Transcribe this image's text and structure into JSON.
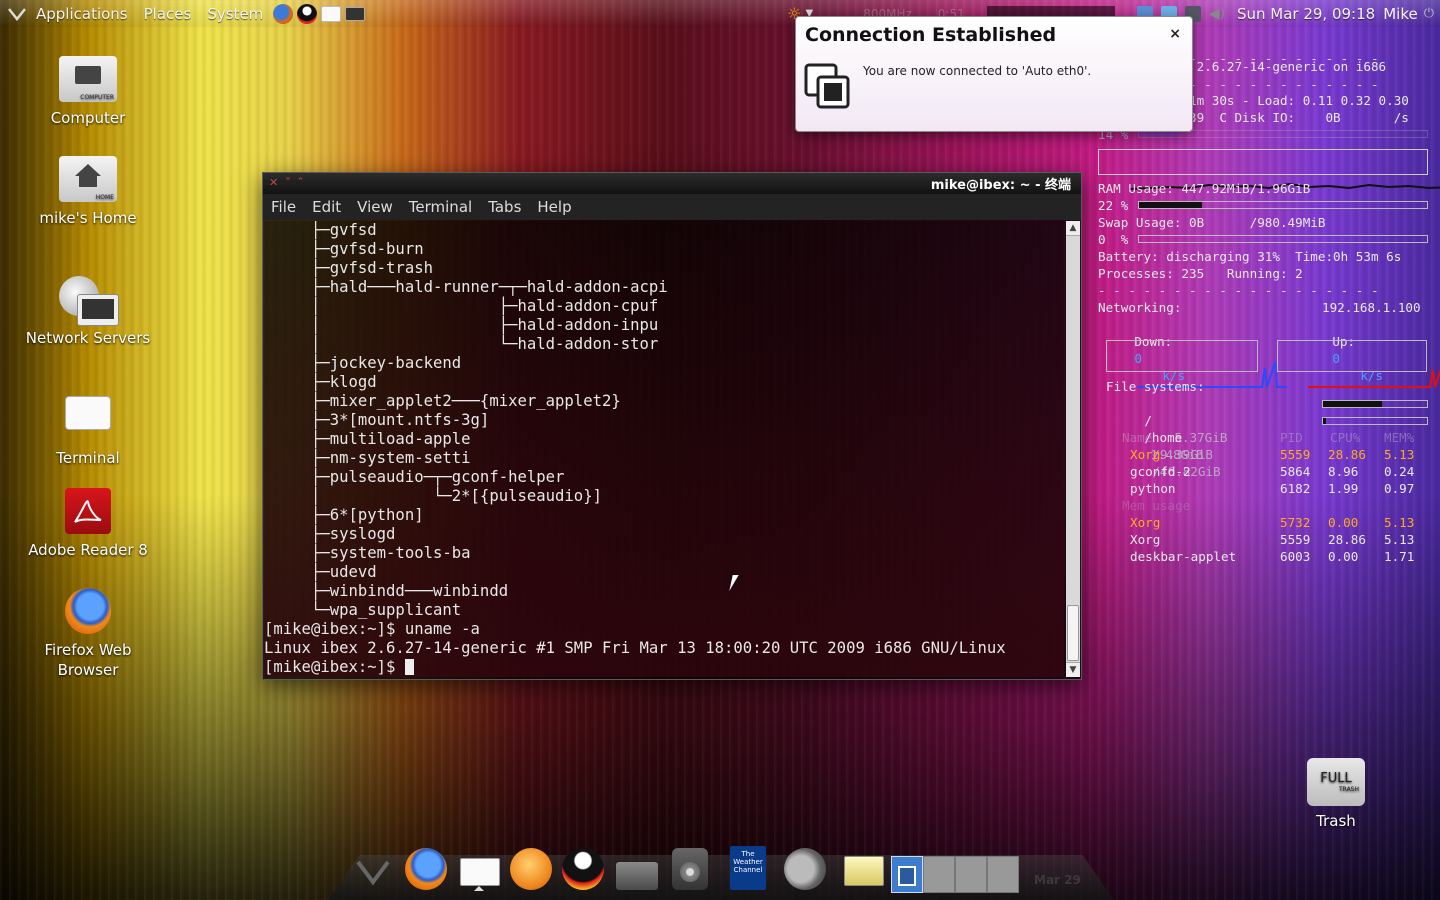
{
  "top_panel": {
    "menus": [
      "Applications",
      "Places",
      "System"
    ],
    "clock": "Sun Mar 29, 09:18",
    "user": "Mike",
    "partial_cpu": "800MHz",
    "partial_battery": "0:51"
  },
  "desktop_icons": [
    {
      "label": "Computer",
      "badge": "COMPUTER"
    },
    {
      "label": "mike's Home",
      "badge": "HOME"
    },
    {
      "label": "Network Servers",
      "badge": ""
    },
    {
      "label": "Terminal",
      "badge": ""
    },
    {
      "label": "Adobe Reader 8",
      "badge": ""
    },
    {
      "label": "Firefox Web Browser",
      "badge": ""
    }
  ],
  "terminal": {
    "title": "mike@ibex: ~ - 终端",
    "menu": [
      "File",
      "Edit",
      "View",
      "Terminal",
      "Tabs",
      "Help"
    ],
    "lines": [
      "     ├─gvfsd",
      "     ├─gvfsd-burn",
      "     ├─gvfsd-trash",
      "     ├─hald───hald-runner─┬─hald-addon-acpi",
      "     │                   ├─hald-addon-cpuf",
      "     │                   ├─hald-addon-inpu",
      "     │                   └─hald-addon-stor",
      "     ├─jockey-backend",
      "     ├─klogd",
      "     ├─mixer_applet2───{mixer_applet2}",
      "     ├─3*[mount.ntfs-3g]",
      "     ├─multiload-apple",
      "     ├─nm-system-setti",
      "     ├─pulseaudio─┬─gconf-helper",
      "     │            └─2*[{pulseaudio}]",
      "     ├─6*[python]",
      "     ├─syslogd",
      "     ├─system-tools-ba",
      "     ├─udevd",
      "     ├─winbindd───winbindd",
      "     └─wpa_supplicant",
      "[mike@ibex:~]$ uname -a",
      "Linux ibex 2.6.27-14-generic #1 SMP Fri Mar 13 18:00:20 UTC 2009 i686 GNU/Linux",
      "[mike@ibex:~]$ "
    ]
  },
  "notification": {
    "title": "Connection Established",
    "message": "You are now connected to 'Auto eth0'.",
    "close": "×"
  },
  "conky": {
    "host_line": "ibex - Linux 2.6.27-14-generic on i686",
    "uptime_line": "Uptime: 0h 11m 30s - Load: 0.11 0.32 0.30",
    "cpu_line": "CPU Usage:  39  C Disk IO:    0B       /s",
    "cpu_pct": "14 %",
    "cpu_fraction": 0.14,
    "ram_line": "RAM Usage: 447.92MiB/1.96GiB",
    "ram_pct": "22 %",
    "ram_fraction": 0.22,
    "swap_line": "Swap Usage: 0B      /980.49MiB",
    "swap_pct": "0  %",
    "battery_line": "Battery: discharging 31%  Time:0h 53m 6s",
    "processes_line": "Processes: 235   Running: 2",
    "networking_label": "Networking:",
    "ip": "192.168.1.100",
    "down_label": "Down:",
    "down_value": "0",
    "up_label": "Up:",
    "up_value": "0",
    "rate_unit": "k/s",
    "fs_label": "File systems:",
    "fs": [
      {
        "mount": "/",
        "used": "5.37GiB",
        "total": "/9.39GiB",
        "fraction": 0.57
      },
      {
        "mount": "/home",
        "used": "1.48GiB",
        "total": "/46.82GiB",
        "fraction": 0.03
      }
    ],
    "proc_headers": [
      "Name",
      "PID",
      "CPU%",
      "MEM%"
    ],
    "procs_cpu": [
      {
        "name": "Xorg",
        "pid": "5559",
        "cpu": "28.86",
        "mem": "5.13"
      },
      {
        "name": "gconfd-2",
        "pid": "5864",
        "cpu": "8.96",
        "mem": "0.24"
      },
      {
        "name": "python",
        "pid": "6182",
        "cpu": "1.99",
        "mem": "0.97"
      }
    ],
    "mem_usage_label": "Mem usage",
    "procs_mem": [
      {
        "name": "Xorg",
        "pid": "5732",
        "cpu": "0.00",
        "mem": "5.13"
      },
      {
        "name": "Xorg",
        "pid": "5559",
        "cpu": "28.86",
        "mem": "5.13"
      },
      {
        "name": "deskbar-applet",
        "pid": "6003",
        "cpu": "0.00",
        "mem": "1.71"
      }
    ]
  },
  "trash": {
    "label": "Trash",
    "badge": "FULL",
    "sub": "TRASH"
  },
  "dock": {
    "items": [
      "ubuntu-menu-icon",
      "firefox-icon",
      "terminal-icon",
      "pidgin-icon",
      "qq-icon",
      "drive-icon",
      "speaker-icon",
      "weather-icon",
      "volume-icon",
      "notes-icon"
    ],
    "weather_text": "The Weather Channel",
    "date": "Mar 29"
  }
}
